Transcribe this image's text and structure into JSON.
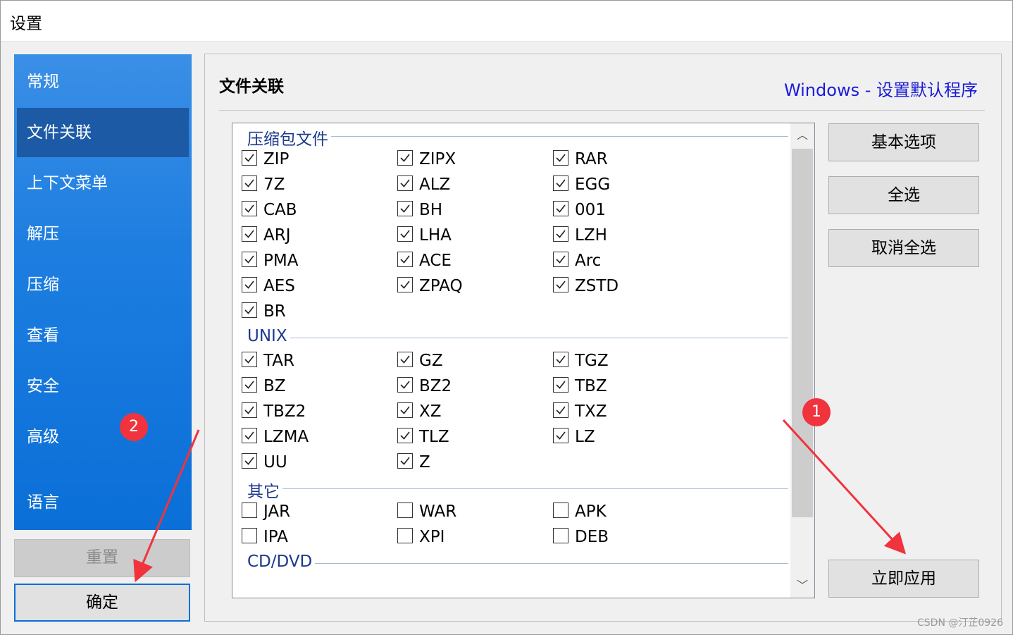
{
  "window": {
    "title": "设置"
  },
  "sidebar": {
    "items": [
      {
        "label": "常规"
      },
      {
        "label": "文件关联"
      },
      {
        "label": "上下文菜单"
      },
      {
        "label": "解压"
      },
      {
        "label": "压缩"
      },
      {
        "label": "查看"
      },
      {
        "label": "安全"
      },
      {
        "label": "高级"
      },
      {
        "label": "语言"
      }
    ],
    "active": "文件关联",
    "reset_label": "重置",
    "ok_label": "确定"
  },
  "panel": {
    "title": "文件关联",
    "link": "Windows - 设置默认程序"
  },
  "groups": [
    {
      "title": "压缩包文件",
      "items": [
        {
          "label": "ZIP",
          "checked": true
        },
        {
          "label": "ZIPX",
          "checked": true
        },
        {
          "label": "RAR",
          "checked": true
        },
        {
          "label": "7Z",
          "checked": true
        },
        {
          "label": "ALZ",
          "checked": true
        },
        {
          "label": "EGG",
          "checked": true
        },
        {
          "label": "CAB",
          "checked": true
        },
        {
          "label": "BH",
          "checked": true
        },
        {
          "label": "001",
          "checked": true
        },
        {
          "label": "ARJ",
          "checked": true
        },
        {
          "label": "LHA",
          "checked": true
        },
        {
          "label": "LZH",
          "checked": true
        },
        {
          "label": "PMA",
          "checked": true
        },
        {
          "label": "ACE",
          "checked": true
        },
        {
          "label": "Arc",
          "checked": true
        },
        {
          "label": "AES",
          "checked": true
        },
        {
          "label": "ZPAQ",
          "checked": true
        },
        {
          "label": "ZSTD",
          "checked": true
        },
        {
          "label": "BR",
          "checked": true
        }
      ]
    },
    {
      "title": "UNIX",
      "items": [
        {
          "label": "TAR",
          "checked": true
        },
        {
          "label": "GZ",
          "checked": true
        },
        {
          "label": "TGZ",
          "checked": true
        },
        {
          "label": "BZ",
          "checked": true
        },
        {
          "label": "BZ2",
          "checked": true
        },
        {
          "label": "TBZ",
          "checked": true
        },
        {
          "label": "TBZ2",
          "checked": true
        },
        {
          "label": "XZ",
          "checked": true
        },
        {
          "label": "TXZ",
          "checked": true
        },
        {
          "label": "LZMA",
          "checked": true
        },
        {
          "label": "TLZ",
          "checked": true
        },
        {
          "label": "LZ",
          "checked": true
        },
        {
          "label": "UU",
          "checked": true
        },
        {
          "label": "Z",
          "checked": true
        }
      ]
    },
    {
      "title": "其它",
      "items": [
        {
          "label": "JAR",
          "checked": false
        },
        {
          "label": "WAR",
          "checked": false
        },
        {
          "label": "APK",
          "checked": false
        },
        {
          "label": "IPA",
          "checked": false
        },
        {
          "label": "XPI",
          "checked": false
        },
        {
          "label": "DEB",
          "checked": false
        }
      ]
    },
    {
      "title": "CD/DVD",
      "items": []
    }
  ],
  "buttons": {
    "basic": "基本选项",
    "select_all": "全选",
    "deselect_all": "取消全选",
    "apply_now": "立即应用"
  },
  "annotations": {
    "badge1": "1",
    "badge2": "2",
    "arrow_color": "#f0333d"
  },
  "watermark": "CSDN @汀芷0926",
  "colors": {
    "sidebar": "#1e7ee0",
    "sidebar_active": "#1c5aa5",
    "link": "#1a1ad6",
    "group_title": "#1c3a8c"
  }
}
